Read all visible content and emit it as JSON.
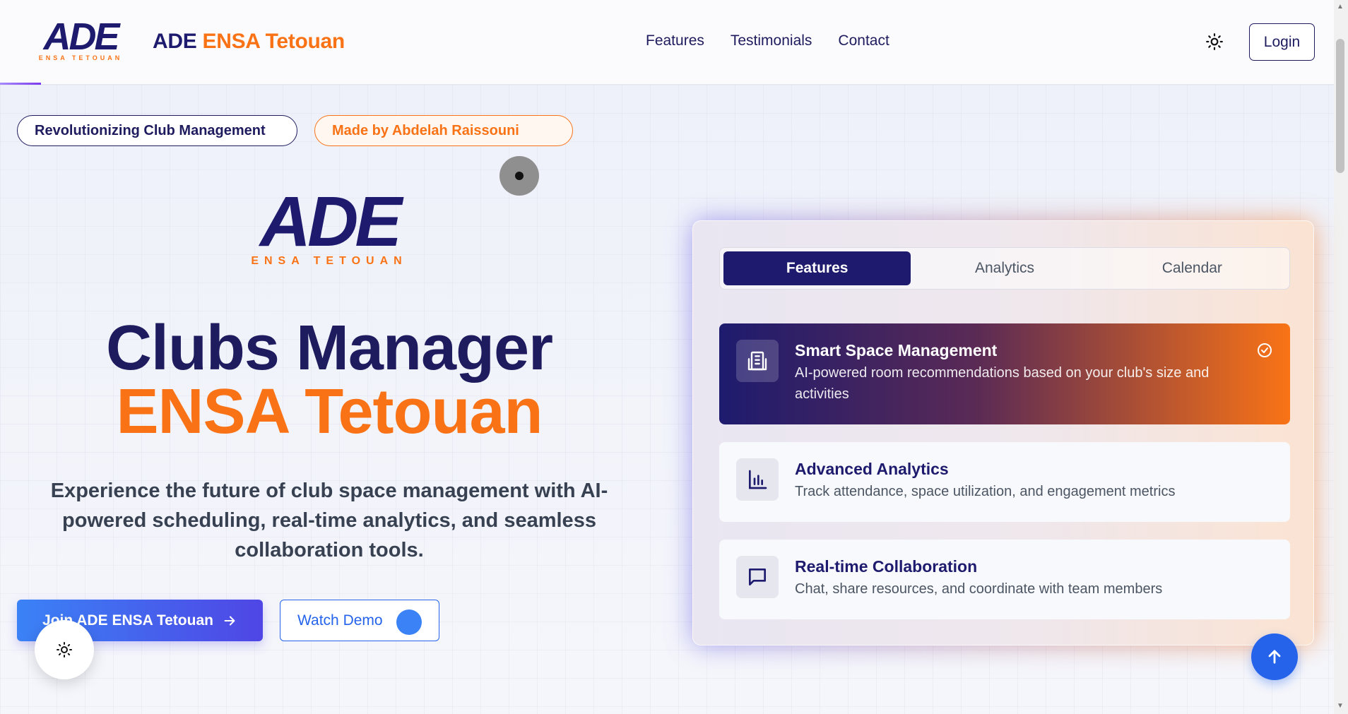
{
  "header": {
    "brand_first": "ADE",
    "brand_second": "ENSA Tetouan",
    "logo_tagline": "ENSA TETOUAN",
    "nav": [
      "Features",
      "Testimonials",
      "Contact"
    ],
    "login_label": "Login",
    "theme_icon": "sun-icon"
  },
  "hero": {
    "badge_primary": "Revolutionizing Club Management",
    "badge_author": "Made by Abdelah Raissouni",
    "logo_letters": "ADE",
    "logo_tagline": "ENSA TETOUAN",
    "title_line1": "Clubs Manager",
    "title_line2": "ENSA Tetouan",
    "description": "Experience the future of club space management with AI-powered scheduling, real-time analytics, and seamless collaboration tools.",
    "cta_primary": "Join ADE ENSA Tetouan",
    "cta_secondary": "Watch Demo"
  },
  "card": {
    "tabs": [
      "Features",
      "Analytics",
      "Calendar"
    ],
    "active_tab": "Features",
    "features": [
      {
        "title": "Smart Space Management",
        "description": "AI-powered room recommendations based on your club's size and activities",
        "icon": "building-icon",
        "active": true
      },
      {
        "title": "Advanced Analytics",
        "description": "Track attendance, space utilization, and engagement metrics",
        "icon": "bar-chart-icon",
        "active": false
      },
      {
        "title": "Real-time Collaboration",
        "description": "Chat, share resources, and coordinate with team members",
        "icon": "chat-icon",
        "active": false
      }
    ]
  },
  "colors": {
    "navy": "#1e1b6e",
    "orange": "#f97316",
    "blue": "#2563eb"
  }
}
